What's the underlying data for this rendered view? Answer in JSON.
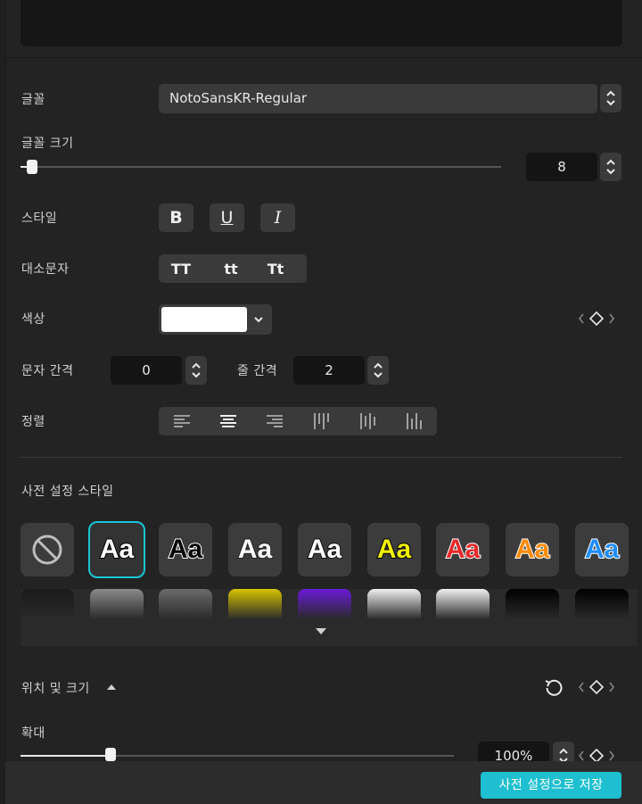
{
  "text": {
    "font_label": "글꼴",
    "font_value": "NotoSansKR-Regular",
    "size_label": "글꼴 크기",
    "size_value": "8",
    "size_fraction": 0.02,
    "style_label": "스타일",
    "style_buttons": [
      "B",
      "U",
      "I"
    ],
    "case_label": "대소문자",
    "case_options": [
      "TT",
      "tt",
      "Tt"
    ],
    "color_label": "색상",
    "color_value": "#ffffff",
    "letter_spacing_label": "문자 간격",
    "letter_spacing_value": "0",
    "line_spacing_label": "줄 간격",
    "line_spacing_value": "2",
    "align_label": "정렬"
  },
  "presets": {
    "title": "사전 설정 스타일",
    "row1": [
      {
        "id": "none",
        "label": ""
      },
      {
        "id": "white-black-outline",
        "label": "Aa",
        "fill": "#ffffff",
        "stroke": "#000000",
        "selected": true
      },
      {
        "id": "black-white-outline",
        "label": "Aa",
        "fill": "#000000",
        "stroke": "#ffffff"
      },
      {
        "id": "white-plain",
        "label": "Aa",
        "fill": "#ffffff",
        "stroke": "#222222"
      },
      {
        "id": "white-glow",
        "label": "Aa",
        "fill": "#ffffff",
        "stroke": "#111111"
      },
      {
        "id": "yellow",
        "label": "Aa",
        "fill": "#f2f200",
        "stroke": "#000000"
      },
      {
        "id": "red",
        "label": "Aa",
        "fill": "#e8282a",
        "stroke": "#ffffff"
      },
      {
        "id": "orange",
        "label": "Aa",
        "fill": "#ff8a00",
        "stroke": "#ffffff"
      },
      {
        "id": "blue",
        "label": "Aa",
        "fill": "#1e8cff",
        "stroke": "#ffffff"
      }
    ],
    "row2_colors": [
      "#1a1a1a",
      "#8a8a8a",
      "#6a6a6a",
      "#d8c400",
      "#6a1ad8",
      "#f0f0f0",
      "#f0f0f0",
      "#000000",
      "#000000"
    ],
    "row2_text_colors": [
      "#1e9a2a",
      "#333333",
      "#888888",
      "#333333",
      "#8a4ae8",
      "#5a2aa8",
      "#333333",
      "#555555",
      "#1e9a2a"
    ]
  },
  "position": {
    "title": "위치 및 크기",
    "scale_label": "확대",
    "scale_value": "100%",
    "scale_fraction": 0.207
  },
  "footer": {
    "save_preset": "사전 설정으로 저장"
  },
  "colors": {
    "accent": "#1ebfd0"
  }
}
